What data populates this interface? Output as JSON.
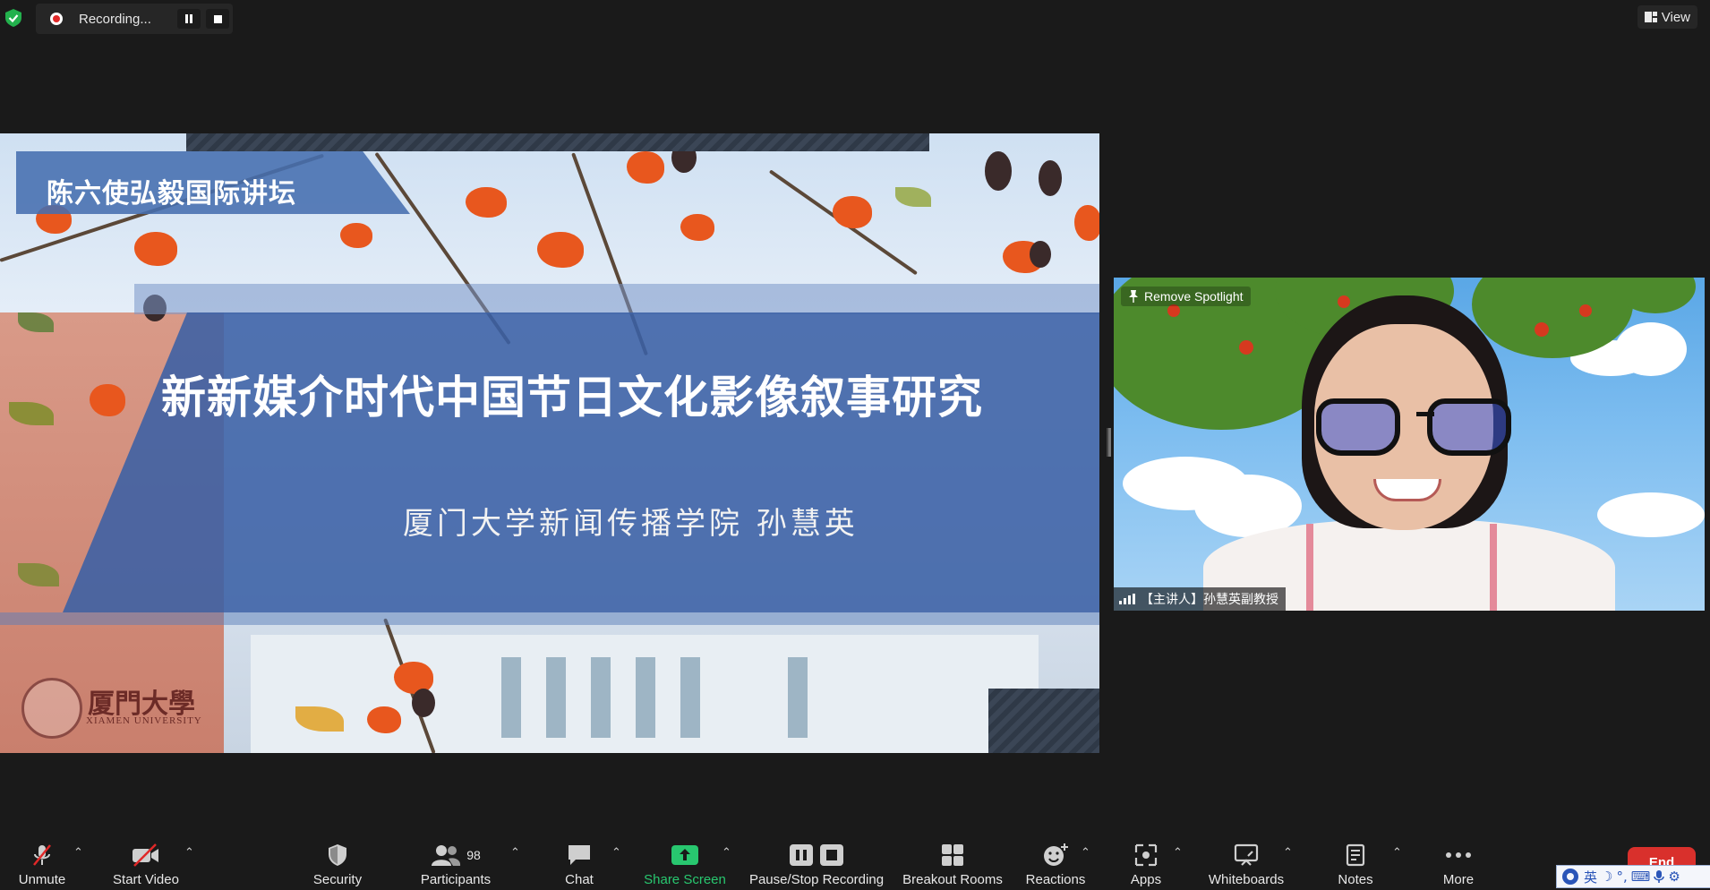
{
  "recording": {
    "status": "Recording..."
  },
  "topbar": {
    "view_label": "View"
  },
  "slide": {
    "forum_title": "陈六使弘毅国际讲坛",
    "title": "新新媒介时代中国节日文化影像叙事研究",
    "subtitle": "厦门大学新闻传播学院  孙慧英",
    "university_cn": "厦門大學",
    "university_en": "XIAMEN UNIVERSITY"
  },
  "video": {
    "spotlight_label": "Remove Spotlight",
    "participant_name": "【主讲人】孙慧英副教授"
  },
  "toolbar": {
    "unmute": "Unmute",
    "start_video": "Start Video",
    "security": "Security",
    "participants": "Participants",
    "participants_count": "98",
    "chat": "Chat",
    "share_screen": "Share Screen",
    "pause_stop_recording": "Pause/Stop Recording",
    "breakout_rooms": "Breakout Rooms",
    "reactions": "Reactions",
    "apps": "Apps",
    "whiteboards": "Whiteboards",
    "notes": "Notes",
    "more": "More",
    "end": "End"
  },
  "ime": {
    "mode": "英"
  },
  "colors": {
    "share_green": "#28c76f",
    "end_red": "#d9302c",
    "recording_red": "#e02828",
    "slide_blue": "#3a60a5"
  }
}
